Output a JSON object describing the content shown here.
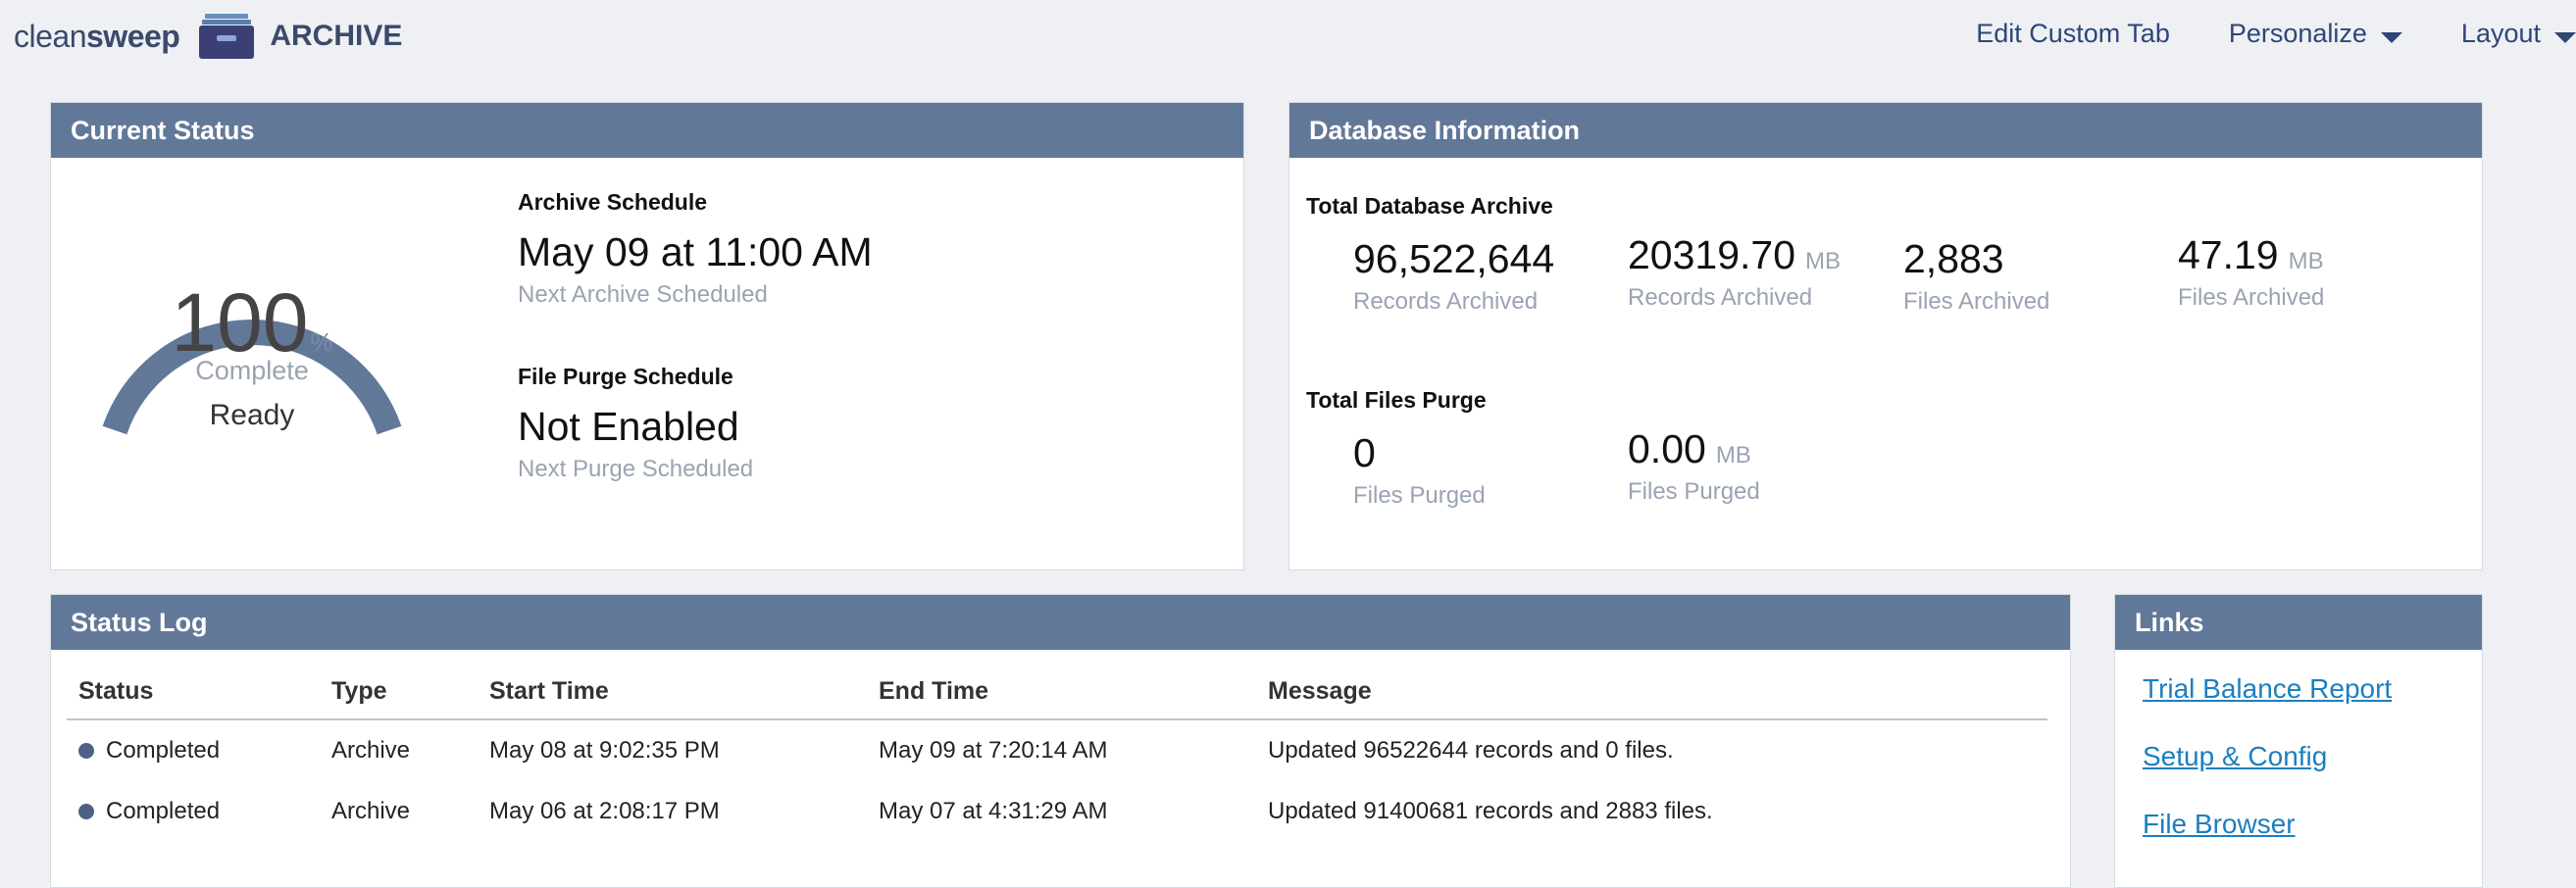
{
  "header": {
    "logo_clean": "clean",
    "logo_sweep": "sweep",
    "logo_archive": "ARCHIVE",
    "nav": [
      {
        "label": "Edit Custom Tab",
        "has_caret": false
      },
      {
        "label": "Personalize",
        "has_caret": true
      },
      {
        "label": "Layout",
        "has_caret": true
      }
    ]
  },
  "current_status": {
    "title": "Current Status",
    "gauge": {
      "value": "100",
      "unit": "%",
      "caption": "Complete",
      "state": "Ready",
      "fraction": 1.0
    },
    "archive_schedule": {
      "title": "Archive Schedule",
      "value": "May 09 at 11:00 AM",
      "sub": "Next Archive Scheduled"
    },
    "purge_schedule": {
      "title": "File Purge Schedule",
      "value": "Not Enabled",
      "sub": "Next Purge Scheduled"
    }
  },
  "database_info": {
    "title": "Database Information",
    "archive_title": "Total Database Archive",
    "archive_stats": [
      {
        "value": "96,522,644",
        "unit": "",
        "label": "Records Archived"
      },
      {
        "value": "20319.70",
        "unit": "MB",
        "label": "Records Archived"
      },
      {
        "value": "2,883",
        "unit": "",
        "label": "Files Archived"
      },
      {
        "value": "47.19",
        "unit": "MB",
        "label": "Files Archived"
      }
    ],
    "purge_title": "Total Files Purge",
    "purge_stats": [
      {
        "value": "0",
        "unit": "",
        "label": "Files Purged"
      },
      {
        "value": "0.00",
        "unit": "MB",
        "label": "Files Purged"
      }
    ]
  },
  "status_log": {
    "title": "Status Log",
    "columns": [
      "Status",
      "Type",
      "Start Time",
      "End Time",
      "Message"
    ],
    "rows": [
      {
        "status": "Completed",
        "type": "Archive",
        "start": "May 08 at 9:02:35 PM",
        "end": "May 09 at 7:20:14 AM",
        "message": "Updated 96522644 records and 0 files."
      },
      {
        "status": "Completed",
        "type": "Archive",
        "start": "May 06 at 2:08:17 PM",
        "end": "May 07 at 4:31:29 AM",
        "message": "Updated 91400681 records and 2883 files."
      }
    ]
  },
  "links": {
    "title": "Links",
    "items": [
      "Trial Balance Report",
      "Setup & Config",
      "File Browser"
    ]
  },
  "colors": {
    "panel_header": "#627899",
    "gauge": "#627899",
    "link": "#1b7fbf",
    "nav_text": "#2d4776"
  }
}
